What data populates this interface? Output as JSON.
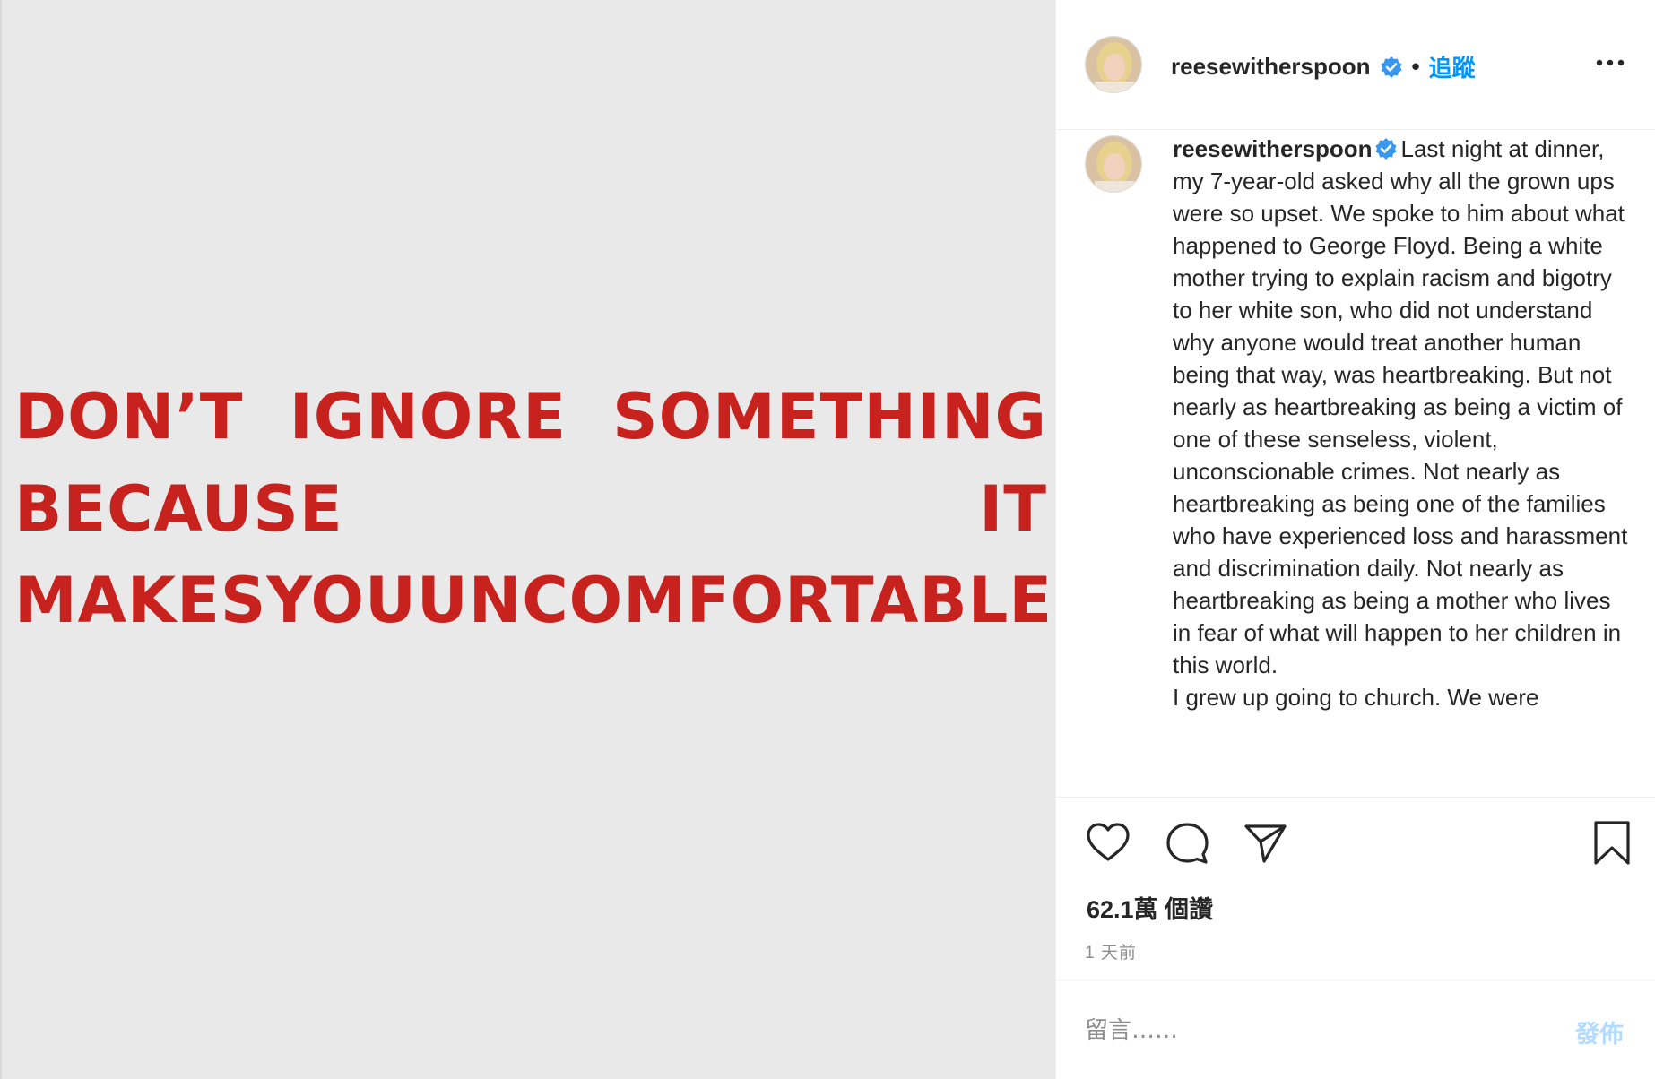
{
  "poster": {
    "line1": [
      "DON’T",
      "IGNORE",
      "SOMETHING"
    ],
    "line2": [
      "BECAUSE",
      "IT"
    ],
    "line3": [
      "MAKES",
      "YOU",
      "UNCOMFORTABLE"
    ],
    "text_color": "#c8221f",
    "background_color": "#e9e9e9"
  },
  "header": {
    "username": "reesewitherspoon",
    "verified_icon": "verified-badge-icon",
    "separator": "•",
    "follow_label": "追蹤",
    "more_icon": "more-options-icon"
  },
  "caption": {
    "username": "reesewitherspoon",
    "paragraph1": "Last night at dinner, my 7-year-old asked why all the grown ups were so upset. We spoke to him about what happened to George Floyd. Being a white mother trying to explain racism and bigotry to her white son, who did not understand why anyone would treat another human being that way, was heartbreaking. But not nearly as heartbreaking as being a victim of one of these senseless, violent, unconscionable crimes. Not nearly as heartbreaking as being one of the families who have experienced loss and harassment and discrimination daily. Not nearly as heartbreaking as being a mother who lives in fear of what will happen to her children in this world.",
    "paragraph2": "I grew up going to church. We were"
  },
  "actions": {
    "like_icon": "heart-icon",
    "comment_icon": "comment-icon",
    "share_icon": "paper-plane-icon",
    "save_icon": "bookmark-icon"
  },
  "likes": "62.1萬 個讚",
  "timestamp": "1 天前",
  "comment": {
    "placeholder": "留言……",
    "post_label": "發佈"
  },
  "colors": {
    "link_blue": "#0095f6",
    "post_button_disabled": "#b3dbff",
    "text_primary": "#262626",
    "text_secondary": "#8e8e8e"
  }
}
